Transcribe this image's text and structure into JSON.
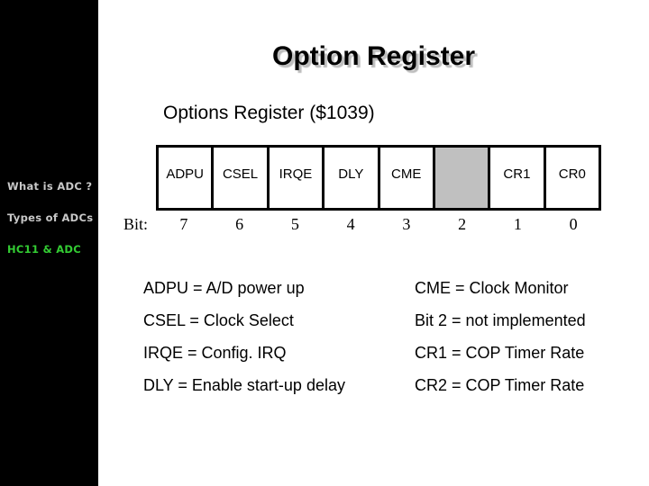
{
  "sidebar": {
    "items": [
      {
        "label": "What is ADC ?",
        "active": false
      },
      {
        "label": "Types of ADCs",
        "active": false
      },
      {
        "label": "HC11 & ADC",
        "active": true
      }
    ]
  },
  "slide": {
    "title": "Option Register",
    "subtitle": "Options Register ($1039)",
    "bit_label": "Bit:",
    "register_cells": [
      {
        "name": "ADPU",
        "bit": "7",
        "implemented": true
      },
      {
        "name": "CSEL",
        "bit": "6",
        "implemented": true
      },
      {
        "name": "IRQE",
        "bit": "5",
        "implemented": true
      },
      {
        "name": "DLY",
        "bit": "4",
        "implemented": true
      },
      {
        "name": "CME",
        "bit": "3",
        "implemented": true
      },
      {
        "name": "",
        "bit": "2",
        "implemented": false
      },
      {
        "name": "CR1",
        "bit": "1",
        "implemented": true
      },
      {
        "name": "CR0",
        "bit": "0",
        "implemented": true
      }
    ],
    "definitions_left": [
      "ADPU = A/D power up",
      "CSEL = Clock Select",
      "IRQE = Config. IRQ",
      "DLY = Enable start-up delay"
    ],
    "definitions_right": [
      "CME = Clock Monitor",
      "Bit 2 = not implemented",
      "CR1 = COP Timer Rate",
      "CR2 = COP Timer Rate"
    ]
  },
  "colors": {
    "sidebar_bg": "#000000",
    "nav_text": "#c8c8c8",
    "nav_active": "#33cc33",
    "unused_bit": "#c0c0c0"
  }
}
